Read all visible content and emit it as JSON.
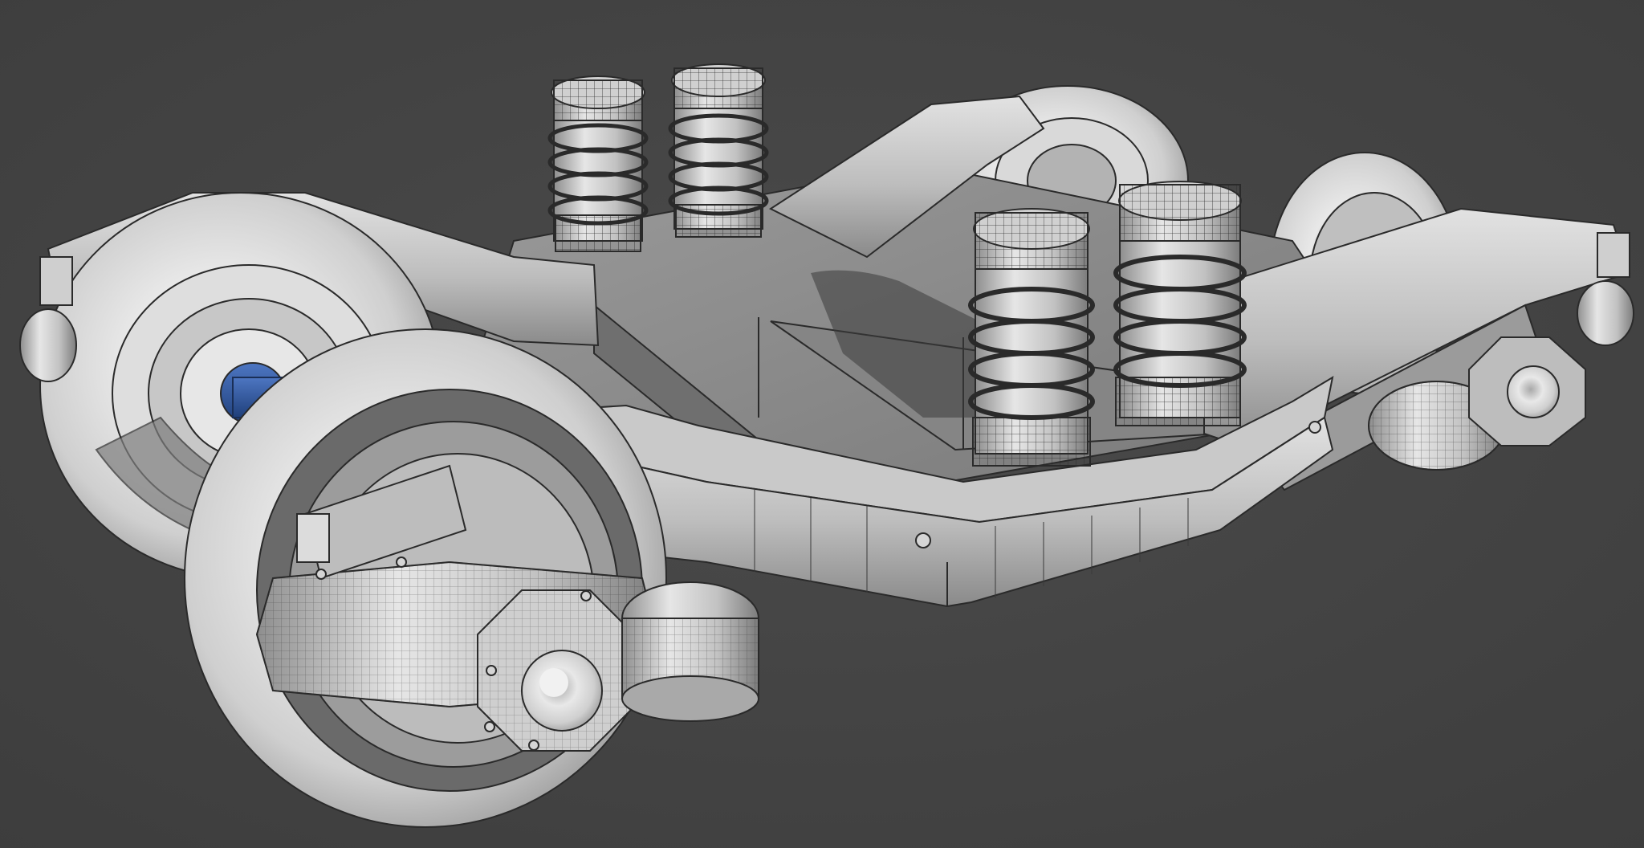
{
  "viewport": {
    "background": "#474747",
    "background_edge": "#3c3c3c"
  },
  "model": {
    "subject": "railway-bogie",
    "material_color": "#c9c9c9",
    "material_highlight": "#efefef",
    "material_shadow": "#6e6e6e",
    "wire_color": "#2a2a2a",
    "axle_color": "#2f5aa6",
    "wheelsets": 2,
    "wheels": 4,
    "coil_springs": 4,
    "axle_boxes": 4
  }
}
